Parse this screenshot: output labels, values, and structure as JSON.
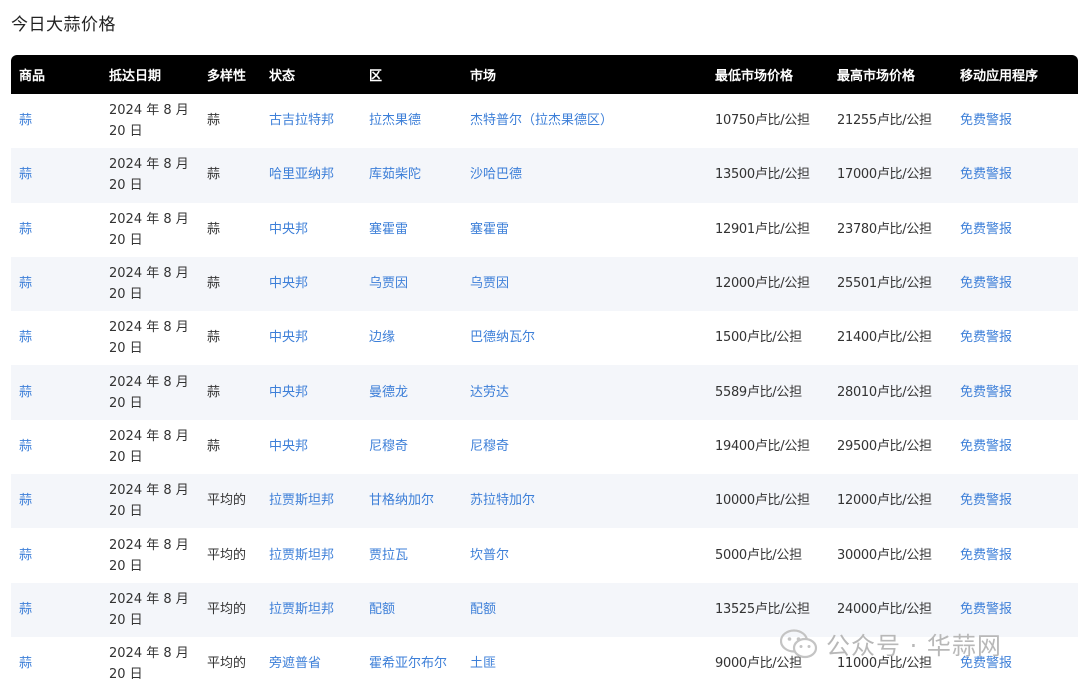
{
  "page": {
    "title": "今日大蒜价格"
  },
  "table": {
    "headers": [
      "商品",
      "抵达日期",
      "多样性",
      "状态",
      "区",
      "市场",
      "最低市场价格",
      "最高市场价格",
      "移动应用程序"
    ],
    "rows": [
      {
        "commodity": "蒜",
        "date": "2024 年 8 月 20 日",
        "variety": "蒜",
        "state": "古吉拉特邦",
        "district": "拉杰果德",
        "market": "杰特普尔（拉杰果德区）",
        "min_price": "10750卢比/公担",
        "max_price": "21255卢比/公担",
        "app": "免费警报"
      },
      {
        "commodity": "蒜",
        "date": "2024 年 8 月 20 日",
        "variety": "蒜",
        "state": "哈里亚纳邦",
        "district": "库茹柴陀",
        "market": "沙哈巴德",
        "min_price": "13500卢比/公担",
        "max_price": "17000卢比/公担",
        "app": "免费警报"
      },
      {
        "commodity": "蒜",
        "date": "2024 年 8 月 20 日",
        "variety": "蒜",
        "state": "中央邦",
        "district": "塞霍雷",
        "market": "塞霍雷",
        "min_price": "12901卢比/公担",
        "max_price": "23780卢比/公担",
        "app": "免费警报"
      },
      {
        "commodity": "蒜",
        "date": "2024 年 8 月 20 日",
        "variety": "蒜",
        "state": "中央邦",
        "district": "乌贾因",
        "market": "乌贾因",
        "min_price": "12000卢比/公担",
        "max_price": "25501卢比/公担",
        "app": "免费警报"
      },
      {
        "commodity": "蒜",
        "date": "2024 年 8 月 20 日",
        "variety": "蒜",
        "state": "中央邦",
        "district": "边缘",
        "market": "巴德纳瓦尔",
        "min_price": "1500卢比/公担",
        "max_price": "21400卢比/公担",
        "app": "免费警报"
      },
      {
        "commodity": "蒜",
        "date": "2024 年 8 月 20 日",
        "variety": "蒜",
        "state": "中央邦",
        "district": "曼德龙",
        "market": "达劳达",
        "min_price": "5589卢比/公担",
        "max_price": "28010卢比/公担",
        "app": "免费警报"
      },
      {
        "commodity": "蒜",
        "date": "2024 年 8 月 20 日",
        "variety": "蒜",
        "state": "中央邦",
        "district": "尼穆奇",
        "market": "尼穆奇",
        "min_price": "19400卢比/公担",
        "max_price": "29500卢比/公担",
        "app": "免费警报"
      },
      {
        "commodity": "蒜",
        "date": "2024 年 8 月 20 日",
        "variety": "平均的",
        "state": "拉贾斯坦邦",
        "district": "甘格纳加尔",
        "market": "苏拉特加尔",
        "min_price": "10000卢比/公担",
        "max_price": "12000卢比/公担",
        "app": "免费警报"
      },
      {
        "commodity": "蒜",
        "date": "2024 年 8 月 20 日",
        "variety": "平均的",
        "state": "拉贾斯坦邦",
        "district": "贾拉瓦",
        "market": "坎普尔",
        "min_price": "5000卢比/公担",
        "max_price": "30000卢比/公担",
        "app": "免费警报"
      },
      {
        "commodity": "蒜",
        "date": "2024 年 8 月 20 日",
        "variety": "平均的",
        "state": "拉贾斯坦邦",
        "district": "配额",
        "market": "配额",
        "min_price": "13525卢比/公担",
        "max_price": "24000卢比/公担",
        "app": "免费警报"
      },
      {
        "commodity": "蒜",
        "date": "2024 年 8 月 20 日",
        "variety": "平均的",
        "state": "旁遮普省",
        "district": "霍希亚尔布尔",
        "market": "土匪",
        "min_price": "9000卢比/公担",
        "max_price": "11000卢比/公担",
        "app": "免费警报"
      }
    ]
  },
  "watermark": {
    "text": "公众号 · 华蒜网",
    "icon": "wechat-icon"
  },
  "colors": {
    "header_bg": "#000000",
    "link": "#3d7fd8",
    "row_alt_bg": "#f4f6fa"
  }
}
